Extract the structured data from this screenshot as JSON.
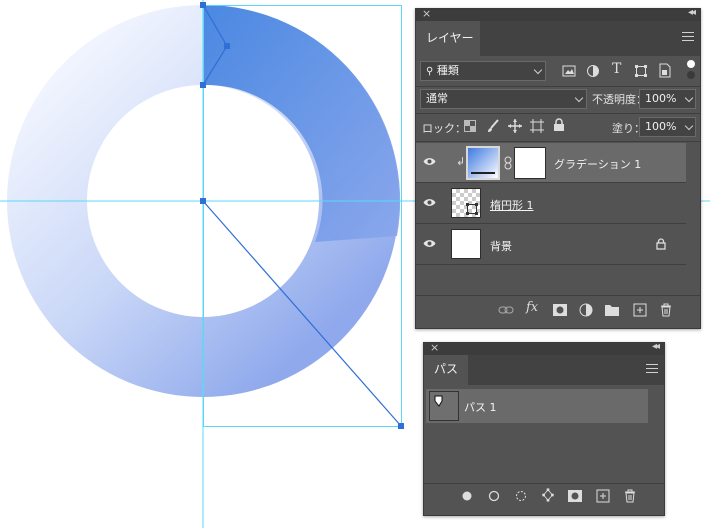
{
  "colors": {
    "panel_bg": "#535353",
    "selected_row": "#6a6a6a",
    "guide": "#55d6f5",
    "gradient_start": "#3f82e0",
    "gradient_end": "#f4f8ff"
  },
  "layers_panel": {
    "tab_label": "レイヤー",
    "filter_value": "種類",
    "blend_mode": "通常",
    "opacity_label": "不透明度：",
    "opacity_value": "100%",
    "lock_label": "ロック：",
    "fill_label": "塗り：",
    "fill_value": "100%",
    "layers": [
      {
        "name": "グラデーション 1",
        "selected": true,
        "visible": true,
        "clipped": true
      },
      {
        "name": "楕円形 1",
        "selected": false,
        "visible": true,
        "clipped": false
      },
      {
        "name": "背景",
        "selected": false,
        "visible": true,
        "locked": true
      }
    ],
    "filter_icons": [
      "image-icon",
      "adjustment-icon",
      "type-icon",
      "shape-icon",
      "smart-object-icon"
    ],
    "lock_icons": [
      "lock-transparent-icon",
      "lock-paint-icon",
      "lock-position-icon",
      "lock-artboard-icon",
      "lock-all-icon"
    ],
    "footer_icons": [
      "link-icon",
      "fx-icon",
      "mask-icon",
      "adjustment-layer-icon",
      "folder-icon",
      "new-layer-icon",
      "trash-icon"
    ]
  },
  "paths_panel": {
    "tab_label": "パス",
    "paths": [
      {
        "name": "パス 1",
        "selected": true
      }
    ],
    "footer_icons": [
      "fill-path-icon",
      "stroke-path-icon",
      "selection-path-icon",
      "work-path-icon",
      "mask-icon",
      "new-path-icon",
      "trash-icon"
    ]
  }
}
